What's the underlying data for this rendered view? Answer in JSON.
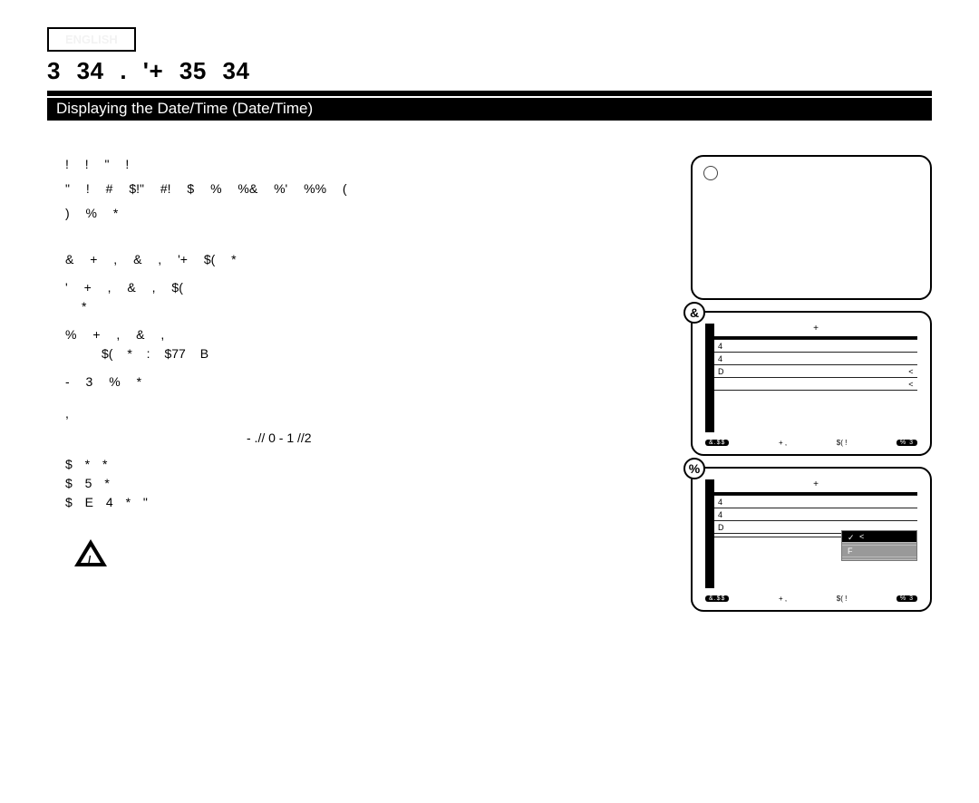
{
  "tag": "ENGLISH",
  "page_title": "3       34 .  '+     35     34",
  "section_bar": "Displaying the Date/Time (Date/Time)",
  "body_lines": [
    "!                                            !               \" !",
    "\" !           #                                          $!\"           #! $  %    %&   %'  %%     (",
    ")              %   *"
  ],
  "steps": [
    {
      "main": "&  + ,         &        ,                                              '+                          $(    *",
      "sub": ""
    },
    {
      "main": "'  + ,         &        ,                                                                     $(",
      "sub": "*",
      "sub_indent": true
    },
    {
      "main": "%  + ,          &        ,",
      "sub": "$(    *                           :              $77                              B"
    },
    {
      "main": "-    3                     %   *",
      "sub": ""
    }
  ],
  "more_heading": ",",
  "off_line": "- .//    0   - 1 //2",
  "list": [
    "$             *     *",
    "$   5                  *",
    "$   E        4             *                                                                           \""
  ],
  "screens": {
    "a_badge": "&",
    "b_badge": "%",
    "menu_title": "+",
    "rows": [
      {
        "left": "",
        "right": ""
      },
      {
        "left": "4",
        "right": ""
      },
      {
        "left": "4",
        "right": ""
      },
      {
        "left": "D",
        "right": "<"
      },
      {
        "left": "",
        "right": "<"
      }
    ],
    "rows_b": [
      {
        "left": "",
        "right": ""
      },
      {
        "left": "4",
        "right": ""
      },
      {
        "left": "4",
        "right": ""
      },
      {
        "left": "D",
        "right": ""
      },
      {
        "left": "",
        "right": ""
      }
    ],
    "footer": {
      "l": "&.$$",
      "m1": "+ ,",
      "m2": "$(    !",
      "r": "%   3"
    },
    "popup": [
      {
        "ck": true,
        "label": "<"
      },
      {
        "ck": false,
        "label": ""
      },
      {
        "ck": false,
        "label": "F"
      },
      {
        "ck": false,
        "label": ""
      }
    ]
  },
  "warn": "/"
}
